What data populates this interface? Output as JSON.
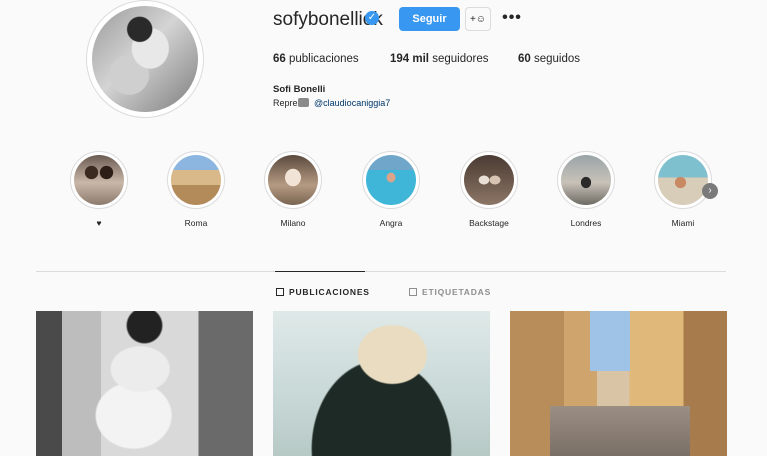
{
  "profile": {
    "username": "sofybonelliok",
    "verified_icon": "verified-badge-icon",
    "follow_label": "Seguir",
    "suggest_icon": "add-person-icon",
    "more_icon": "more-options-icon",
    "stats": {
      "posts_count": "66",
      "posts_label": "publicaciones",
      "followers_count": "194 mil",
      "followers_label": "seguidores",
      "following_count": "60",
      "following_label": "seguidos"
    },
    "full_name": "Sofi Bonelli",
    "bio_prefix": "Repre",
    "bio_mention": "@claudiocaniggia7"
  },
  "highlights": [
    {
      "label": "♥"
    },
    {
      "label": "Roma"
    },
    {
      "label": "Milano"
    },
    {
      "label": "Angra"
    },
    {
      "label": "Backstage"
    },
    {
      "label": "Londres"
    },
    {
      "label": "Miami"
    }
  ],
  "tabs": [
    {
      "label": "PUBLICACIONES",
      "icon": "grid-icon",
      "active": true
    },
    {
      "label": "ETIQUETADAS",
      "icon": "tagged-icon",
      "active": false
    }
  ],
  "colors": {
    "accent": "#3897f0",
    "text": "#262626",
    "muted": "#8e8e8e",
    "background": "#fafafa"
  }
}
